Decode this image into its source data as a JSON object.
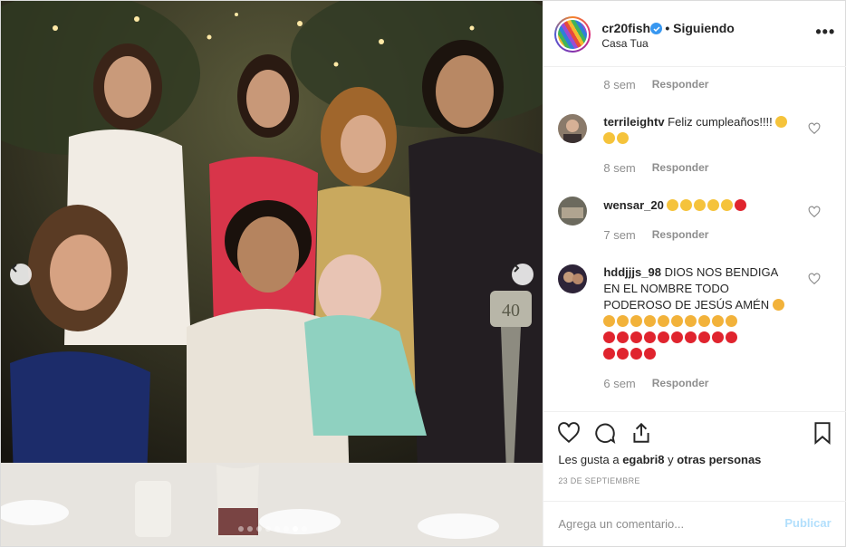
{
  "post": {
    "username": "cr20fish",
    "follow_status": "• Siguiendo",
    "location": "Casa Tua",
    "more_label": "•••"
  },
  "comments": [
    {
      "time": "8 sem",
      "reply": "Responder"
    },
    {
      "username": "terrileightv",
      "text": "Feliz cumpleaños!!!!",
      "emojis": [
        "kiss-emoji",
        "kiss-emoji",
        "kiss-emoji"
      ],
      "time": "8 sem",
      "reply": "Responder"
    },
    {
      "username": "wensar_20",
      "text": "",
      "emojis": [
        "heart-eyes-emoji",
        "heart-eyes-emoji",
        "heart-eyes-emoji",
        "heart-eyes-emoji",
        "heart-eyes-emoji",
        "red-heart-emoji"
      ],
      "time": "7 sem",
      "reply": "Responder"
    },
    {
      "username": "hddjjjs_98",
      "text": "DIOS NOS BENDIGA EN EL NOMBRE TODO PODEROSO DE JESÚS AMÉN",
      "emojis_rows": [
        [
          "pray-emoji"
        ],
        [
          "pray-emoji",
          "pray-emoji",
          "pray-emoji",
          "pray-emoji",
          "pray-emoji",
          "pray-emoji",
          "pray-emoji",
          "pray-emoji",
          "pray-emoji",
          "pray-emoji"
        ],
        [
          "red-heart-emoji",
          "red-heart-emoji",
          "red-heart-emoji",
          "red-heart-emoji",
          "red-heart-emoji",
          "red-heart-emoji",
          "red-heart-emoji",
          "red-heart-emoji",
          "red-heart-emoji",
          "red-heart-emoji"
        ],
        [
          "red-heart-emoji",
          "red-heart-emoji",
          "red-heart-emoji",
          "red-heart-emoji"
        ]
      ],
      "time": "6 sem",
      "reply": "Responder"
    }
  ],
  "likes": {
    "prefix": "Les gusta a",
    "user": "egabri8",
    "joiner": "y",
    "others": "otras personas"
  },
  "date": "23 de septiembre",
  "add_comment": {
    "placeholder": "Agrega un comentario...",
    "publish": "Publicar"
  },
  "carousel": {
    "dots": 8,
    "active_index": 6
  },
  "colors": {
    "accent": "#3897f0",
    "publish_disabled": "#b2dffc",
    "muted": "#8e8e8e"
  }
}
